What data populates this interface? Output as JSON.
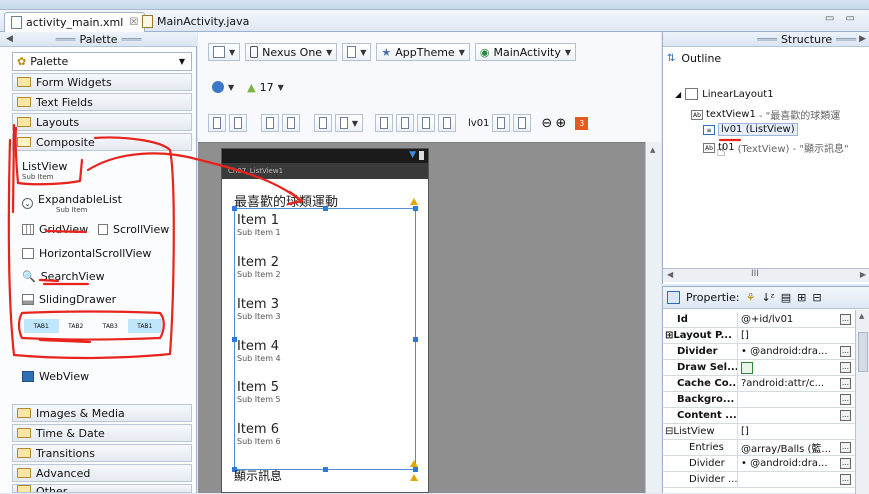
{
  "tabs": [
    {
      "label": "activity_main.xml",
      "close": "☒"
    },
    {
      "label": "MainActivity.java"
    }
  ],
  "palette": {
    "header": "Palette",
    "combo": "Palette",
    "categories": [
      "Form Widgets",
      "Text Fields",
      "Layouts",
      "Composite"
    ],
    "composite_items": [
      {
        "label": "ListView",
        "sub": "Sub Item"
      },
      {
        "label": "ExpandableList",
        "sub": "Sub Item"
      },
      {
        "label": "GridView"
      },
      {
        "label": "ScrollView"
      },
      {
        "label": "HorizontalScrollView"
      },
      {
        "label": "SearchView"
      },
      {
        "label": "SlidingDrawer"
      },
      {
        "label": "WebView"
      }
    ],
    "tab_host": [
      "TAB1",
      "TAB2",
      "TAB3",
      "TAB1"
    ],
    "bottom_categories": [
      "Images & Media",
      "Time & Date",
      "Transitions",
      "Advanced",
      "Other"
    ]
  },
  "toolbar": {
    "device": "Nexus One",
    "theme": "AppTheme",
    "activity": "MainActivity",
    "api": "17",
    "id_label": "lv01"
  },
  "device_screen": {
    "title": "Ch07_ListView1",
    "heading": "最喜歡的球類運動",
    "items": [
      {
        "title": "Item 1",
        "sub": "Sub Item 1"
      },
      {
        "title": "Item 2",
        "sub": "Sub Item 2"
      },
      {
        "title": "Item 3",
        "sub": "Sub Item 3"
      },
      {
        "title": "Item 4",
        "sub": "Sub Item 4"
      },
      {
        "title": "Item 5",
        "sub": "Sub Item 5"
      },
      {
        "title": "Item 6",
        "sub": "Sub Item 6"
      }
    ],
    "footer": "顯示訊息"
  },
  "structure": {
    "header": "Structure",
    "outline_title": "Outline",
    "tree": {
      "root": "LinearLayout1",
      "children": [
        {
          "name": "textView1",
          "detail": "- \"最喜歡的球類運"
        },
        {
          "name": "lv01 (ListView)",
          "detail": ""
        },
        {
          "name": "t01",
          "detail": "(TextView) - \"顯示訊息\""
        }
      ]
    },
    "hscroll_label": "III"
  },
  "properties": {
    "header": "Propertie:",
    "rows": [
      {
        "key": "Id",
        "value": "@+id/lv01",
        "bold": true
      },
      {
        "key": "Layout P...",
        "value": "[]",
        "bold": true,
        "expander": "⊞"
      },
      {
        "key": "Divider",
        "value": "• @android:dra...",
        "bold": true
      },
      {
        "key": "Draw Sel...",
        "value": "",
        "bold": true,
        "checkbox": true
      },
      {
        "key": "Cache Co...",
        "value": "?android:attr/c...",
        "bold": true
      },
      {
        "key": "Backgro...",
        "value": "",
        "bold": true
      },
      {
        "key": "Content ...",
        "value": "",
        "bold": true
      },
      {
        "key": "ListView",
        "value": "[]",
        "bold": false,
        "expander": "⊟"
      },
      {
        "key": "Entries",
        "value": "@array/Balls (籃...",
        "bold": false,
        "indent": true
      },
      {
        "key": "Divider",
        "value": "• @android:dra...",
        "bold": false,
        "indent": true
      },
      {
        "key": "Divider ...",
        "value": "",
        "bold": false,
        "indent": true
      }
    ]
  },
  "colors": {
    "annotation": "#e8231c",
    "selection": "#2f7ad9"
  }
}
